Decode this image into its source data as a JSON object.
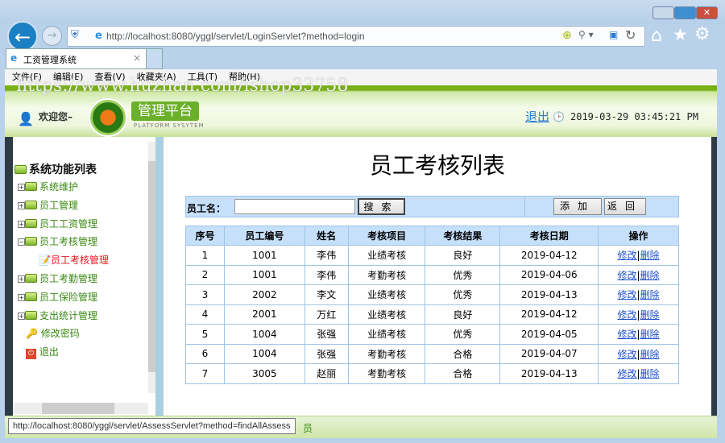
{
  "browser": {
    "url": "http://localhost:8080/yggl/servlet/LoginServlet?method=login",
    "tab_title": "工资管理系统",
    "menu": [
      "文件(F)",
      "编辑(E)",
      "查看(V)",
      "收藏夹(A)",
      "工具(T)",
      "帮助(H)"
    ],
    "status_url": "http://localhost:8080/yggl/servlet/AssessServlet?method=findAllAssess"
  },
  "watermark": "https://www.huzhan.com/ishop33758",
  "header": {
    "welcome": "欢迎您–",
    "logo_title": "管理平台",
    "logo_sub": "PLATFORM SYSYTEM",
    "logout": "退出",
    "datetime": "2019-03-29 03:45:21 PM"
  },
  "sidebar": {
    "title": "系统功能列表",
    "items": [
      {
        "label": "系统维护"
      },
      {
        "label": "员工管理"
      },
      {
        "label": "员工工资管理"
      },
      {
        "label": "员工考核管理"
      },
      {
        "label": "员工考核管理"
      },
      {
        "label": "员工考勤管理"
      },
      {
        "label": "员工保险管理"
      },
      {
        "label": "支出统计管理"
      },
      {
        "label": "修改密码"
      },
      {
        "label": "退出"
      }
    ]
  },
  "main": {
    "title": "员工考核列表",
    "search_label": "员工名：",
    "search_value": "",
    "search_btn": "搜索",
    "add_btn": "添加",
    "back_btn": "返回",
    "columns": [
      "序号",
      "员工编号",
      "姓名",
      "考核项目",
      "考核结果",
      "考核日期",
      "操作"
    ],
    "rows": [
      [
        "1",
        "1001",
        "李伟",
        "业绩考核",
        "良好",
        "2019-04-12"
      ],
      [
        "2",
        "1001",
        "李伟",
        "考勤考核",
        "优秀",
        "2019-04-06"
      ],
      [
        "3",
        "2002",
        "李文",
        "业绩考核",
        "优秀",
        "2019-04-13"
      ],
      [
        "4",
        "2001",
        "万红",
        "业绩考核",
        "良好",
        "2019-04-12"
      ],
      [
        "5",
        "1004",
        "张强",
        "业绩考核",
        "优秀",
        "2019-04-05"
      ],
      [
        "6",
        "1004",
        "张强",
        "考勤考核",
        "合格",
        "2019-04-07"
      ],
      [
        "7",
        "3005",
        "赵丽",
        "考勤考核",
        "合格",
        "2019-04-13"
      ]
    ],
    "edit": "修改",
    "delete": "删除"
  },
  "footer": {
    "text": "员"
  }
}
